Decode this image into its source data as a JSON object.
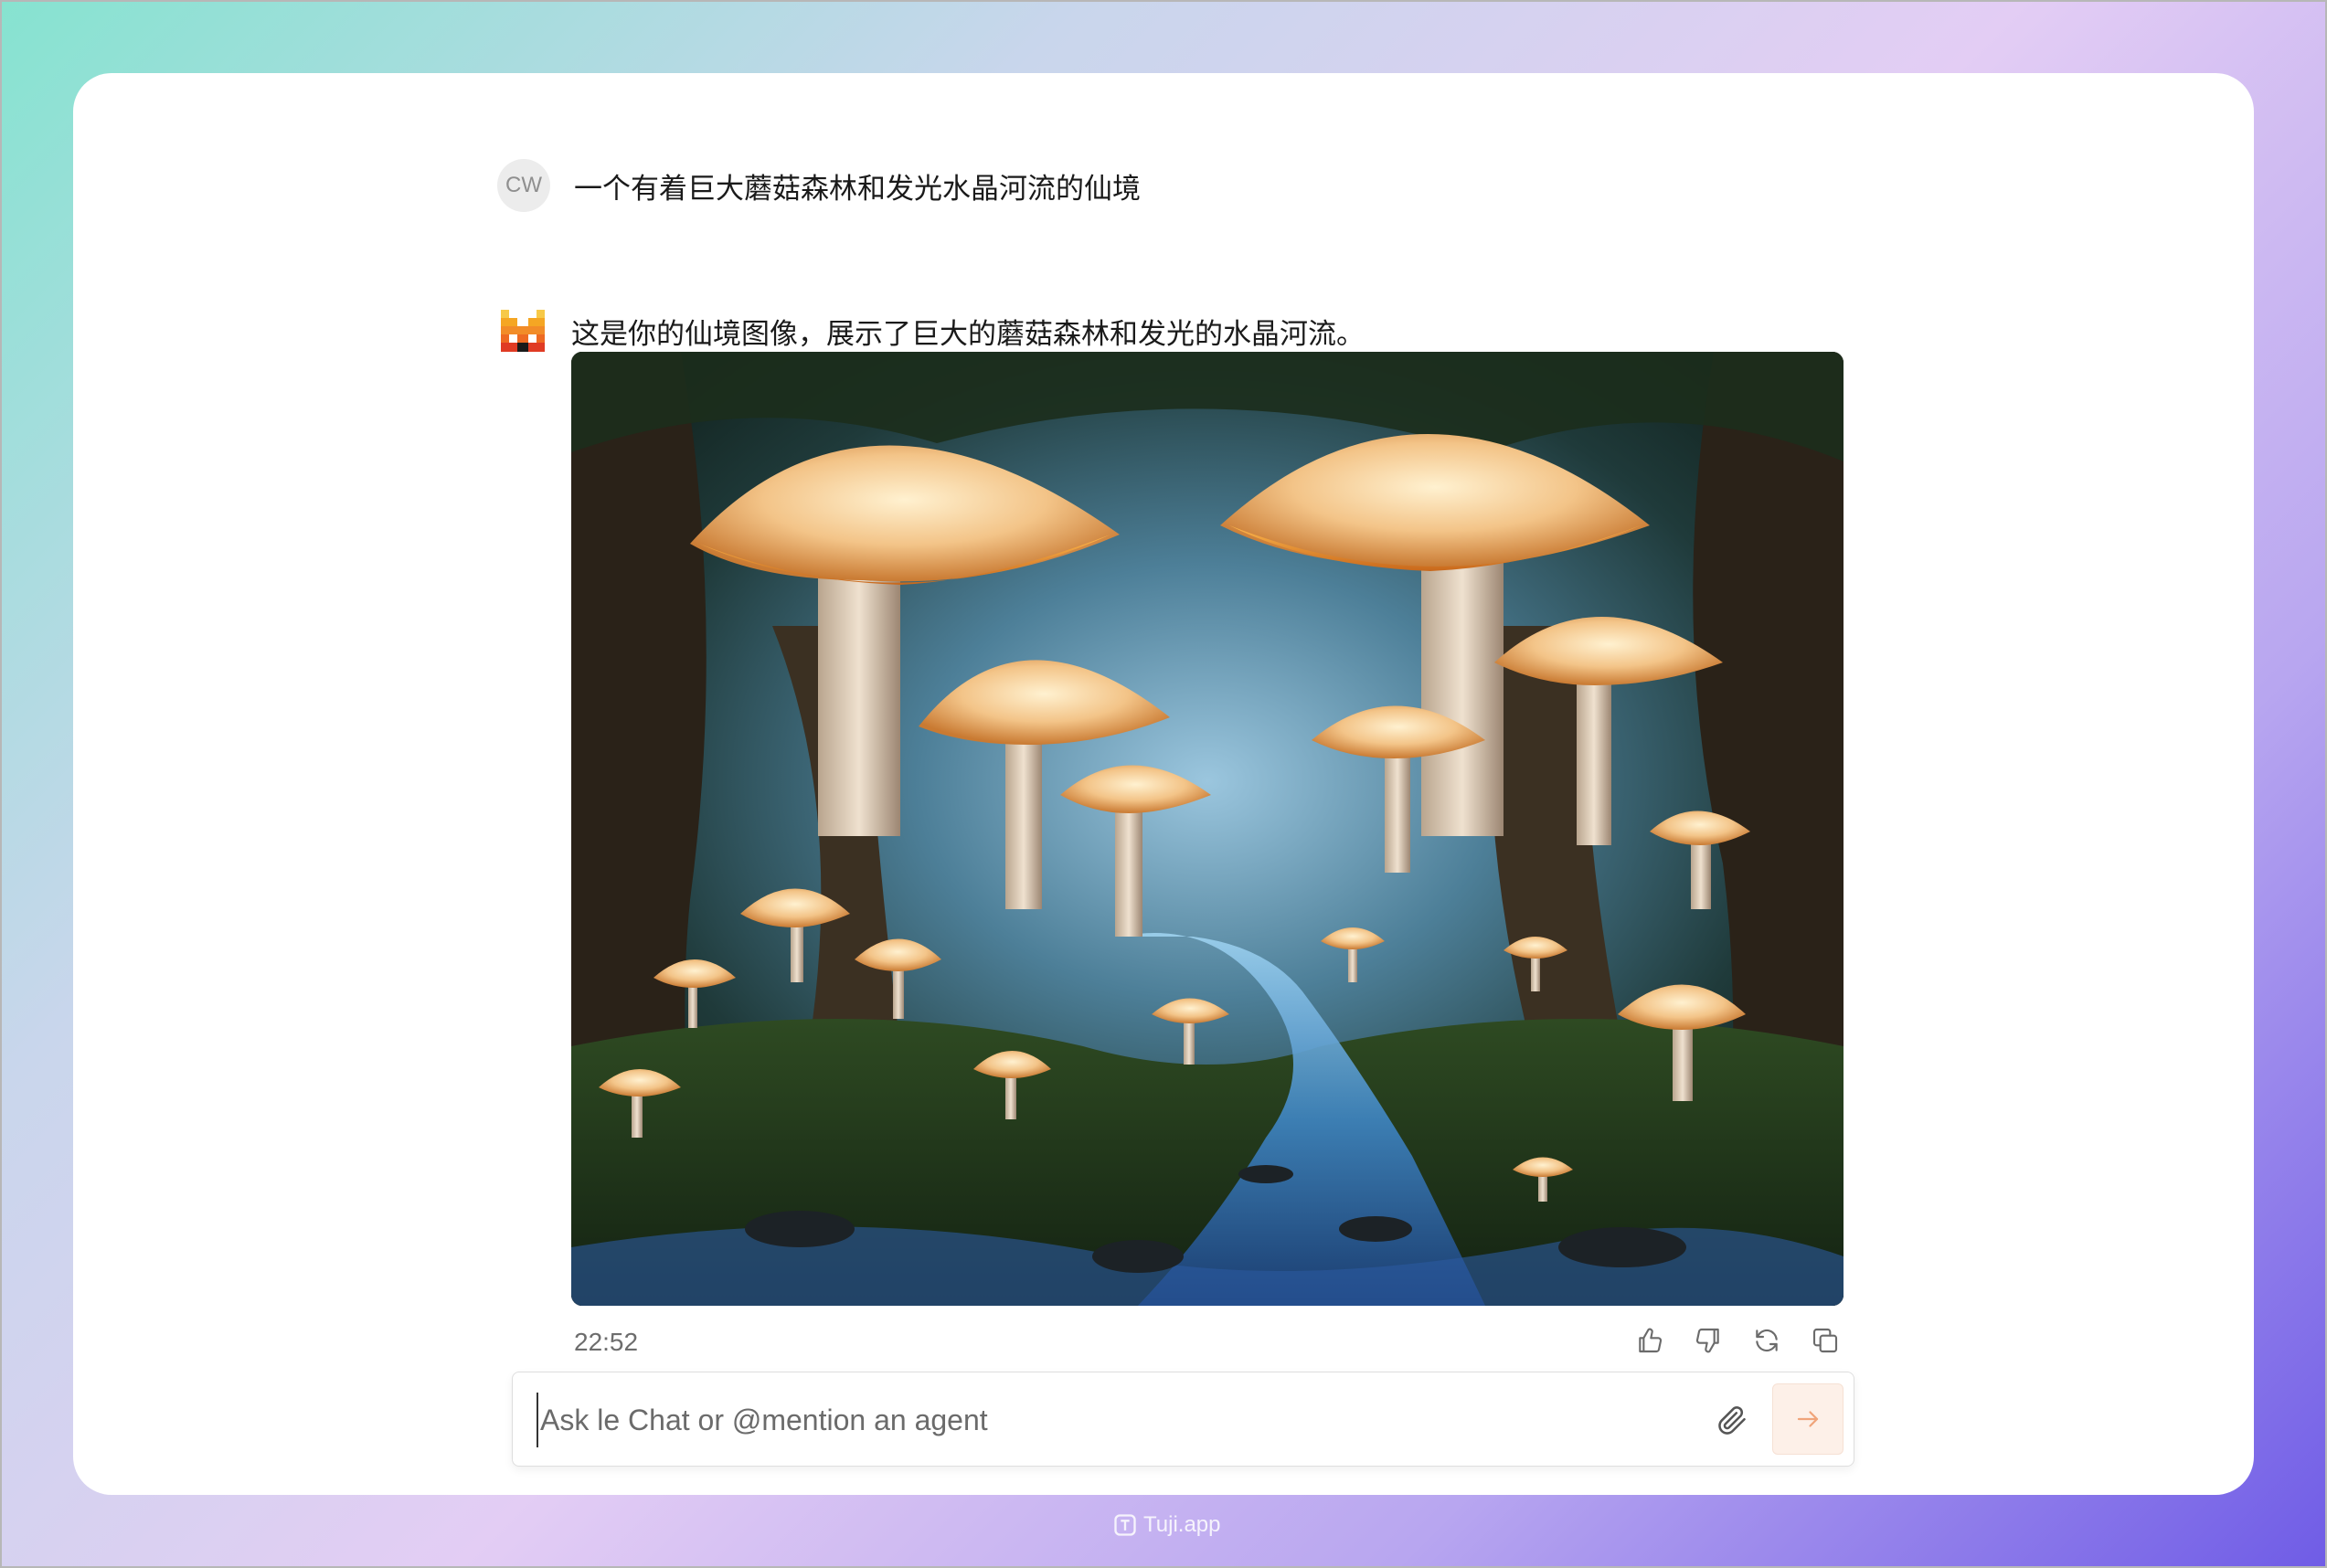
{
  "conversation": {
    "user": {
      "initials": "CW",
      "message": "一个有着巨大蘑菇森林和发光水晶河流的仙境"
    },
    "assistant": {
      "logo": "mistral-logo-icon",
      "message": "这是你的仙境图像，展示了巨大的蘑菇森林和发光的水晶河流。",
      "image_subject": "giant glowing mushroom forest with a luminous crystal river",
      "timestamp": "22:52",
      "actions": [
        "thumbs-up-icon",
        "thumbs-down-icon",
        "regenerate-icon",
        "copy-icon"
      ]
    }
  },
  "composer": {
    "placeholder": "Ask le Chat or @mention an agent",
    "value": "",
    "attach_icon": "paperclip-icon",
    "send_icon": "arrow-right-icon"
  },
  "watermark": {
    "icon": "tuji-icon",
    "text": "Tuji.app"
  },
  "colors": {
    "background_gradient": [
      "#86e3d0",
      "#e3cdf4",
      "#6f5ce6"
    ],
    "card": "#ffffff",
    "send_button_bg": "#fdf0e8",
    "send_arrow": "#f0a47a",
    "logo_orange": "#f28c28",
    "logo_red": "#e03b24"
  }
}
